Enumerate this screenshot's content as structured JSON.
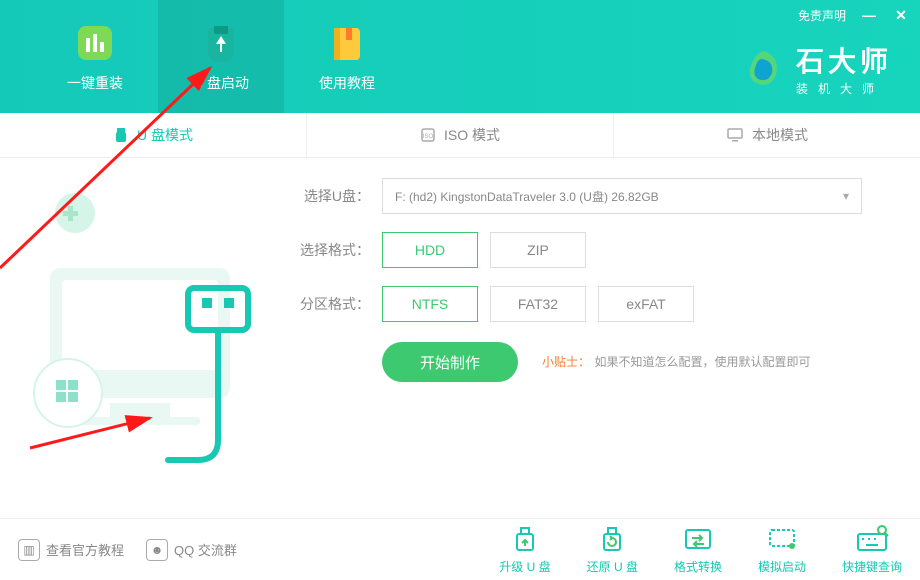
{
  "window": {
    "disclaimer": "免责声明",
    "minimize": "—",
    "close": "✕"
  },
  "brand": {
    "title": "石大师",
    "subtitle": "装机大师"
  },
  "nav": [
    {
      "label": "一键重装"
    },
    {
      "label": "U 盘启动"
    },
    {
      "label": "使用教程"
    }
  ],
  "modes": [
    {
      "label": "U 盘模式"
    },
    {
      "label": "ISO 模式"
    },
    {
      "label": "本地模式"
    }
  ],
  "form": {
    "select_u_label": "选择U盘：",
    "select_u_value": "F:  (hd2) KingstonDataTraveler 3.0 (U盘) 26.82GB",
    "format_label": "选择格式：",
    "formats": [
      "HDD",
      "ZIP"
    ],
    "partition_label": "分区格式：",
    "partitions": [
      "NTFS",
      "FAT32",
      "exFAT"
    ]
  },
  "action": {
    "start": "开始制作",
    "tip_label": "小贴士：",
    "tip_text": "如果不知道怎么配置，使用默认配置即可"
  },
  "help": {
    "official": "查看官方教程",
    "qq": "QQ 交流群"
  },
  "tools": [
    {
      "label": "升级 U 盘"
    },
    {
      "label": "还原 U 盘"
    },
    {
      "label": "格式转换"
    },
    {
      "label": "模拟启动"
    },
    {
      "label": "快捷键查询"
    }
  ]
}
